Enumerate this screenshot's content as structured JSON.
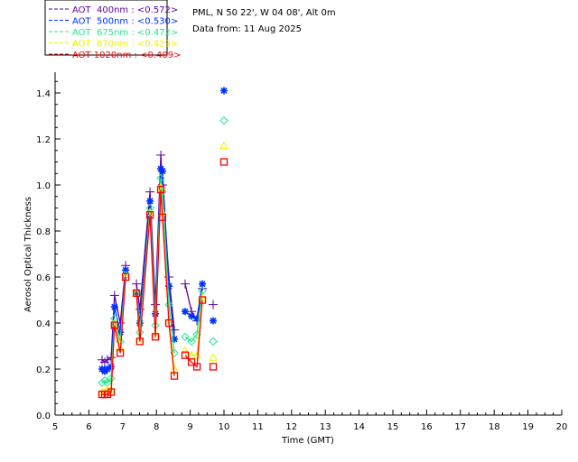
{
  "header": {
    "location": "PML, N 50 22', W 04 08', Alt 0m",
    "date": "Data from: 11 Aug 2025"
  },
  "chart_data": {
    "type": "line",
    "xlabel": "Time (GMT)",
    "ylabel": "Aerosol Optical Thickness",
    "xlim": [
      5,
      20
    ],
    "ylim": [
      0,
      1.5
    ],
    "xticks": [
      "5",
      "6",
      "7",
      "8",
      "9",
      "10",
      "11",
      "12",
      "13",
      "14",
      "15",
      "16",
      "17",
      "18",
      "19",
      "20"
    ],
    "yticks": [
      "0.0",
      "0.2",
      "0.4",
      "0.6",
      "0.8",
      "1.0",
      "1.2",
      "1.4"
    ],
    "legend_placement": "top-left",
    "x": [
      6.39,
      6.47,
      6.55,
      6.66,
      6.76,
      6.93,
      7.09,
      7.41,
      7.51,
      7.81,
      7.97,
      8.13,
      8.18,
      8.37,
      8.53,
      8.85,
      9.04,
      9.2,
      9.36,
      9.68,
      10.0
    ],
    "series": [
      {
        "name": "AOT  400nm : <0.572>",
        "color": "#5a00a0",
        "marker": "plus",
        "values": [
          0.24,
          0.23,
          0.24,
          0.25,
          0.52,
          0.4,
          0.65,
          0.57,
          0.46,
          0.97,
          0.48,
          1.13,
          1.0,
          0.6,
          0.37,
          0.57,
          0.45,
          0.41,
          0.55,
          0.48,
          null
        ]
      },
      {
        "name": "AOT  500nm : <0.530>",
        "color": "#0030ff",
        "marker": "asterisk",
        "values": [
          0.2,
          0.19,
          0.2,
          0.21,
          0.47,
          0.36,
          0.63,
          0.53,
          0.4,
          0.93,
          0.44,
          1.07,
          1.06,
          0.56,
          0.33,
          0.45,
          0.43,
          0.42,
          0.57,
          0.41,
          1.41
        ]
      },
      {
        "name": "AOT  675nm : <0.472>",
        "color": "#20e890",
        "marker": "diamond",
        "values": [
          0.14,
          0.15,
          0.14,
          0.16,
          0.42,
          0.32,
          0.61,
          0.53,
          0.36,
          0.9,
          0.39,
          1.03,
          0.97,
          0.48,
          0.27,
          0.34,
          0.32,
          0.35,
          0.54,
          0.32,
          1.28
        ]
      },
      {
        "name": "AOT  870nm : <0.429>",
        "color": "#f0f000",
        "marker": "triangle",
        "values": [
          0.1,
          0.1,
          0.11,
          0.11,
          0.4,
          0.29,
          0.6,
          0.53,
          0.33,
          0.88,
          0.35,
          0.99,
          0.88,
          0.41,
          0.2,
          0.28,
          0.26,
          0.26,
          0.51,
          0.25,
          1.17
        ]
      },
      {
        "name": "AOT 1020nm : <0.409>",
        "color": "#ff0000",
        "marker": "square",
        "values": [
          0.09,
          0.09,
          0.09,
          0.1,
          0.39,
          0.27,
          0.6,
          0.53,
          0.32,
          0.87,
          0.34,
          0.98,
          0.86,
          0.4,
          0.17,
          0.26,
          0.23,
          0.21,
          0.5,
          0.21,
          1.1
        ]
      }
    ]
  }
}
